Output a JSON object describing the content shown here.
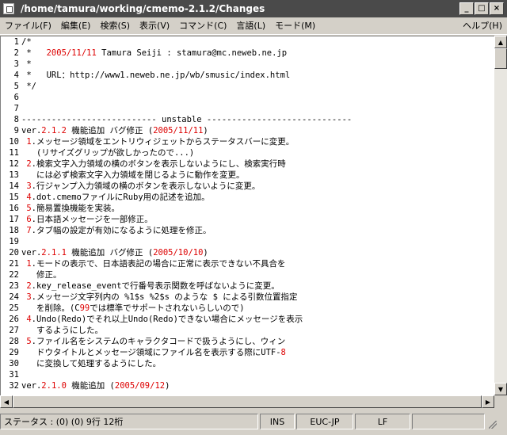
{
  "window": {
    "title": "/home/tamura/working/cmemo-2.1.2/Changes"
  },
  "menu": [
    "ファイル(F)",
    "編集(E)",
    "検索(S)",
    "表示(V)",
    "コマンド(C)",
    "言語(L)",
    "モード(M)"
  ],
  "menu_help": "ヘルプ(H)",
  "lines": [
    [
      {
        "t": "/*"
      }
    ],
    [
      {
        "t": " *   "
      },
      {
        "t": "2005/11/11",
        "c": "red"
      },
      {
        "t": " Tamura Seiji : stamura@mc.neweb.ne.jp"
      }
    ],
    [
      {
        "t": " *"
      }
    ],
    [
      {
        "t": " *   URL：http://www1.neweb.ne.jp/wb/smusic/index.html"
      }
    ],
    [
      {
        "t": " */"
      }
    ],
    [
      {
        "t": ""
      }
    ],
    [
      {
        "t": ""
      }
    ],
    [
      {
        "t": "--------------------------- unstable -----------------------------"
      }
    ],
    [
      {
        "t": "ver."
      },
      {
        "t": "2.1.2",
        "c": "red"
      },
      {
        "t": " 機能追加 バグ修正 ("
      },
      {
        "t": "2005/11/11",
        "c": "red"
      },
      {
        "t": ")"
      }
    ],
    [
      {
        "t": " "
      },
      {
        "t": "1",
        "c": "red"
      },
      {
        "t": ".メッセージ領域をエントリウィジェットからステータスバーに変更。"
      }
    ],
    [
      {
        "t": "   (リサイズグリップが欲しかったので...)"
      }
    ],
    [
      {
        "t": " "
      },
      {
        "t": "2",
        "c": "red"
      },
      {
        "t": ".検索文字入力領域の横のボタンを表示しないようにし、検索実行時"
      }
    ],
    [
      {
        "t": "   には必ず検索文字入力領域を閉じるように動作を変更。"
      }
    ],
    [
      {
        "t": " "
      },
      {
        "t": "3",
        "c": "red"
      },
      {
        "t": ".行ジャンプ入力領域の横のボタンを表示しないように変更。"
      }
    ],
    [
      {
        "t": " "
      },
      {
        "t": "4",
        "c": "red"
      },
      {
        "t": ".dot.cmemoファイルにRuby用の記述を追加。"
      }
    ],
    [
      {
        "t": " "
      },
      {
        "t": "5",
        "c": "red"
      },
      {
        "t": ".簡易置換機能を実装。"
      }
    ],
    [
      {
        "t": " "
      },
      {
        "t": "6",
        "c": "red"
      },
      {
        "t": ".日本語メッセージを一部修正。"
      }
    ],
    [
      {
        "t": " "
      },
      {
        "t": "7",
        "c": "red"
      },
      {
        "t": ".タブ幅の設定が有効になるように処理を修正。"
      }
    ],
    [
      {
        "t": ""
      }
    ],
    [
      {
        "t": "ver."
      },
      {
        "t": "2.1.1",
        "c": "red"
      },
      {
        "t": " 機能追加 バグ修正 ("
      },
      {
        "t": "2005/10/10",
        "c": "red"
      },
      {
        "t": ")"
      }
    ],
    [
      {
        "t": " "
      },
      {
        "t": "1",
        "c": "red"
      },
      {
        "t": ".モードの表示で、日本語表記の場合に正常に表示できない不具合を"
      }
    ],
    [
      {
        "t": "   修正。"
      }
    ],
    [
      {
        "t": " "
      },
      {
        "t": "2",
        "c": "red"
      },
      {
        "t": ".key_release_eventで行番号表示関数を呼ばないように変更。"
      }
    ],
    [
      {
        "t": " "
      },
      {
        "t": "3",
        "c": "red"
      },
      {
        "t": ".メッセージ文字列内の %1$s %2$s のような $ による引数位置指定"
      }
    ],
    [
      {
        "t": "   を削除。(C"
      },
      {
        "t": "99",
        "c": "red"
      },
      {
        "t": "では標準でサポートされないらしいので)"
      }
    ],
    [
      {
        "t": " "
      },
      {
        "t": "4",
        "c": "red"
      },
      {
        "t": ".Undo(Redo)でそれ以上Undo(Redo)できない場合にメッセージを表示"
      }
    ],
    [
      {
        "t": "   するようにした。"
      }
    ],
    [
      {
        "t": " "
      },
      {
        "t": "5",
        "c": "red"
      },
      {
        "t": ".ファイル名をシステムのキャラクタコードで扱うようにし、ウィン"
      }
    ],
    [
      {
        "t": "   ドウタイトルとメッセージ領域にファイル名を表示する際にUTF-"
      },
      {
        "t": "8",
        "c": "red"
      }
    ],
    [
      {
        "t": "   に変換して処理するようにした。"
      }
    ],
    [
      {
        "t": ""
      }
    ],
    [
      {
        "t": "ver."
      },
      {
        "t": "2.1.0",
        "c": "red"
      },
      {
        "t": " 機能追加 ("
      },
      {
        "t": "2005/09/12",
        "c": "red"
      },
      {
        "t": ")"
      }
    ]
  ],
  "status": {
    "message": "ステータス : (0) (0) 9行 12桁",
    "ins": "INS",
    "encoding": "EUC-JP",
    "eol": "LF"
  },
  "colors": {
    "red": "#dd0000",
    "titlebar": "#4a4a4a",
    "chrome": "#d4d0c8"
  }
}
